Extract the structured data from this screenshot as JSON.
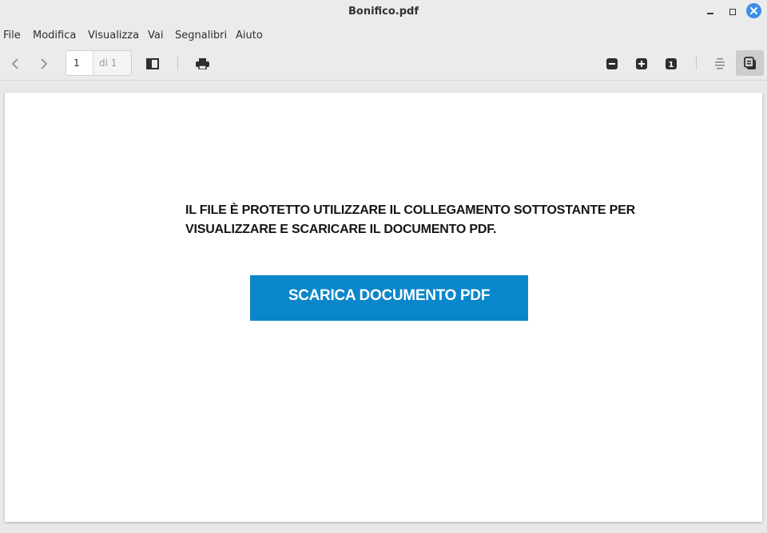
{
  "window": {
    "title": "Bonifico.pdf"
  },
  "menu": [
    "File",
    "Modifica",
    "Visualizza",
    "Vai",
    "Segnalibri",
    "Aiuto"
  ],
  "toolbar": {
    "current_page": "1",
    "total_pages": "di 1",
    "zoom_reset_label": "1"
  },
  "document": {
    "message_line1": "IL FILE È PROTETTO UTILIZZARE IL COLLEGAMENTO SOTTOSTANTE PER",
    "message_line2": "VISUALIZZARE E SCARICARE IL DOCUMENTO PDF.",
    "download_button": "SCARICA DOCUMENTO PDF",
    "button_color": "#0a86cb"
  },
  "colors": {
    "close_button": "#3a8ee6",
    "toolbar_bg": "#ebebeb"
  }
}
